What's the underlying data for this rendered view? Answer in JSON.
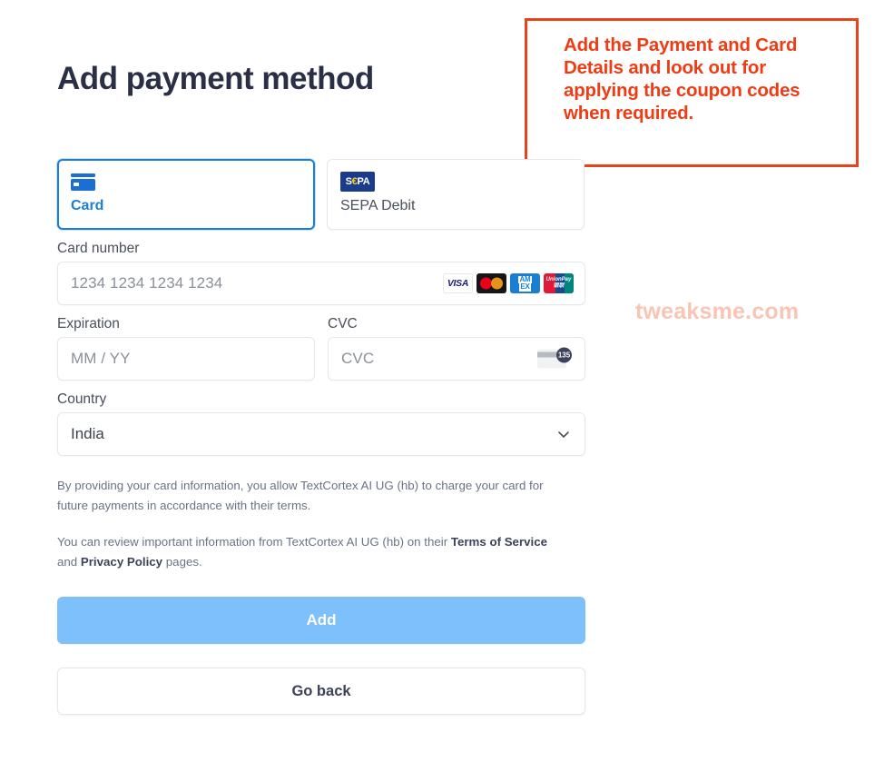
{
  "page": {
    "title": "Add payment method",
    "watermark": "tweaksme.com"
  },
  "annotation": {
    "text": "Add the Payment and Card Details and look out for applying the coupon codes when required.",
    "border_color": "#e8441c",
    "text_color": "#f03c14"
  },
  "payment_methods": {
    "tabs": [
      {
        "id": "card",
        "label": "Card",
        "icon": "credit-card-icon",
        "selected": true
      },
      {
        "id": "sepa_debit",
        "label": "SEPA Debit",
        "icon": "sepa-logo-icon",
        "selected": false
      }
    ]
  },
  "form": {
    "card_number": {
      "label": "Card number",
      "placeholder": "1234 1234 1234 1234",
      "value": "",
      "brands": [
        "visa-icon",
        "mastercard-icon",
        "amex-icon",
        "unionpay-icon"
      ],
      "brand_labels": {
        "visa": "VISA",
        "amex_line1": "AM",
        "amex_line2": "EX",
        "unionpay_line1": "UnionPay",
        "unionpay_line2": "银联"
      }
    },
    "expiration": {
      "label": "Expiration",
      "placeholder": "MM / YY",
      "value": ""
    },
    "cvc": {
      "label": "CVC",
      "placeholder": "CVC",
      "value": "",
      "hint_icon": "cvc-card-back-icon",
      "hint_badge": "135"
    },
    "country": {
      "label": "Country",
      "selected": "India",
      "chevron": "chevron-down-icon"
    }
  },
  "disclaimer": {
    "paragraph1": "By providing your card information, you allow TextCortex AI UG (hb) to charge your card for future payments in accordance with their terms.",
    "paragraph2_part1": "You can review important information from TextCortex AI UG (hb) on their ",
    "paragraph2_link1": "Terms of Service",
    "paragraph2_mid": " and ",
    "paragraph2_link2": "Privacy Policy",
    "paragraph2_end": " pages."
  },
  "actions": {
    "submit_label": "Add",
    "back_label": "Go back",
    "submit_color": "#7dc0fb"
  }
}
